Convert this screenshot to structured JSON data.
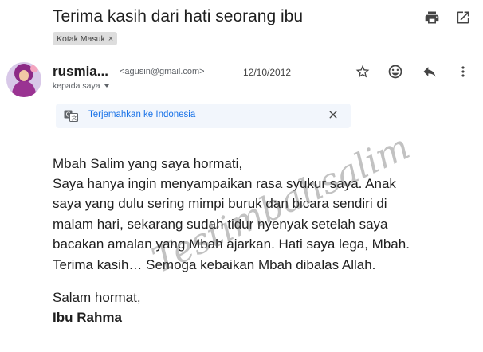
{
  "header": {
    "subject": "Terima kasih dari hati seorang ibu",
    "label": "Kotak Masuk",
    "label_remove": "×",
    "icons": {
      "print": "print-icon",
      "open_new_window": "open-in-new-window-icon"
    }
  },
  "message": {
    "sender_name": "rusmia...",
    "sender_email": "<agusin@gmail.com>",
    "date": "12/10/2012",
    "to_line": "kepada saya",
    "actions": [
      "star-icon",
      "emoji-react-icon",
      "reply-icon",
      "more-vert-icon"
    ]
  },
  "translate": {
    "link": "Terjemahkan ke Indonesia",
    "close": "×"
  },
  "body": {
    "lines": [
      "Mbah Salim yang saya hormati,",
      "Saya hanya ingin menyampaikan rasa syukur saya. Anak",
      "saya yang dulu sering mimpi buruk dan bicara sendiri di",
      "malam hari, sekarang sudah tidur nyenyak setelah saya",
      "bacakan amalan yang Mbah ajarkan. Hati saya lega, Mbah.",
      "Terima kasih… Semoga kebaikan Mbah dibalas Allah."
    ],
    "closing": "Salam hormat,",
    "signature": "Ibu Rahma"
  },
  "watermark": "Testimbahsalim",
  "colors": {
    "link": "#1a73e8",
    "translate_bg": "#f2f6fc",
    "chip_bg": "#dddddd"
  }
}
